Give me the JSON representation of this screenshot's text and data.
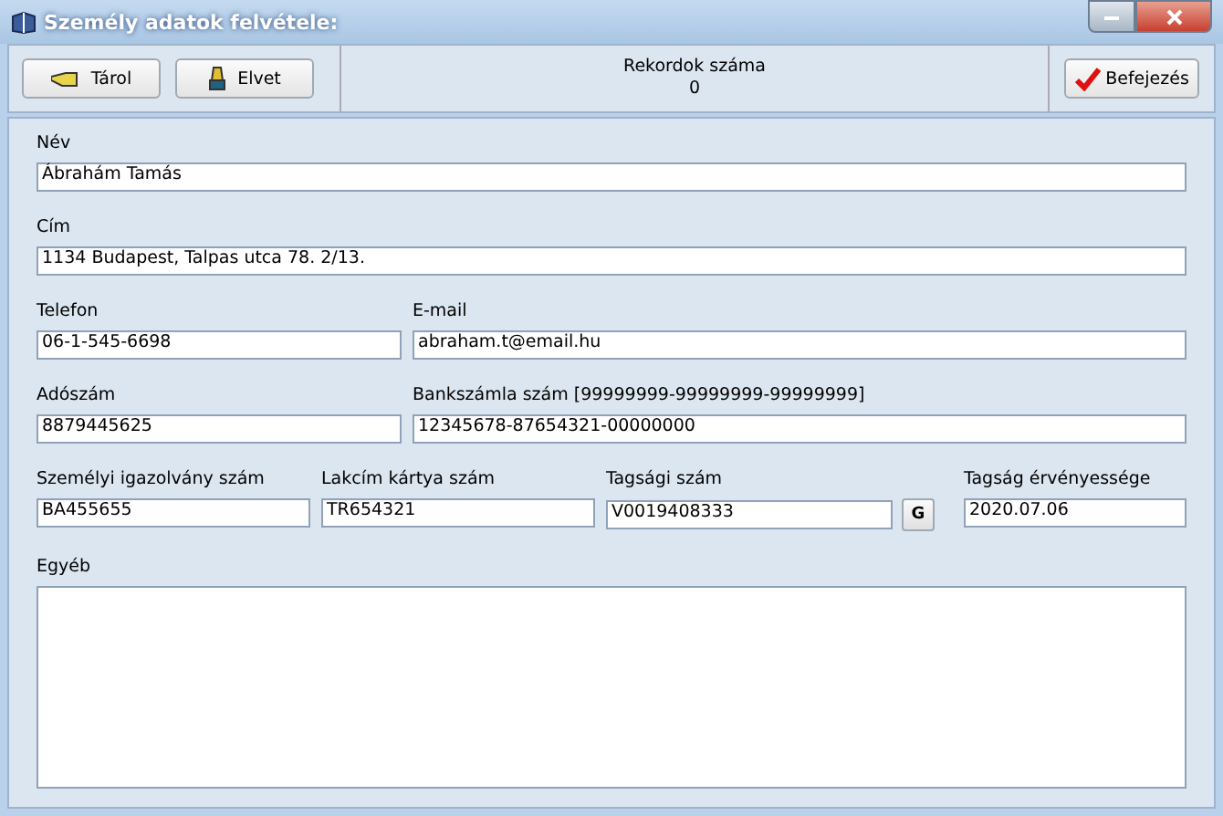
{
  "window": {
    "title": "Személy adatok felvétele:"
  },
  "toolbar": {
    "buttons": [
      {
        "label": "Tárol",
        "kind": "store"
      },
      {
        "label": "Elvet",
        "kind": "discard"
      }
    ],
    "record_count": {
      "label": "Rekordok száma",
      "value": "0"
    },
    "finish_button": {
      "label": "Befejezés"
    }
  },
  "form": {
    "rows": [
      [
        {
          "label": "Név",
          "value": "Ábrahám Tamás"
        }
      ],
      [
        {
          "label": "Cím",
          "value": "1134 Budapest, Talpas utca 78. 2/13."
        }
      ],
      [
        {
          "label": "Telefon",
          "value": "06-1-545-6698"
        },
        {
          "label": "E-mail",
          "value": "abraham.t@email.hu"
        }
      ],
      [
        {
          "label": "Adószám",
          "value": "8879445625"
        },
        {
          "label": "Bankszámla szám [99999999-99999999-99999999]",
          "value": "12345678-87654321-00000000"
        }
      ],
      [
        {
          "label": "Személyi igazolvány szám",
          "value": "BA455655"
        },
        {
          "label": "Lakcím kártya szám",
          "value": "TR654321"
        },
        {
          "label": "Tagsági szám",
          "value": "V0019408333",
          "button": "G"
        },
        {
          "label": "Tagság érvényessége",
          "value": "2020.07.06"
        }
      ]
    ],
    "notes": {
      "label": "Egyéb"
    }
  }
}
